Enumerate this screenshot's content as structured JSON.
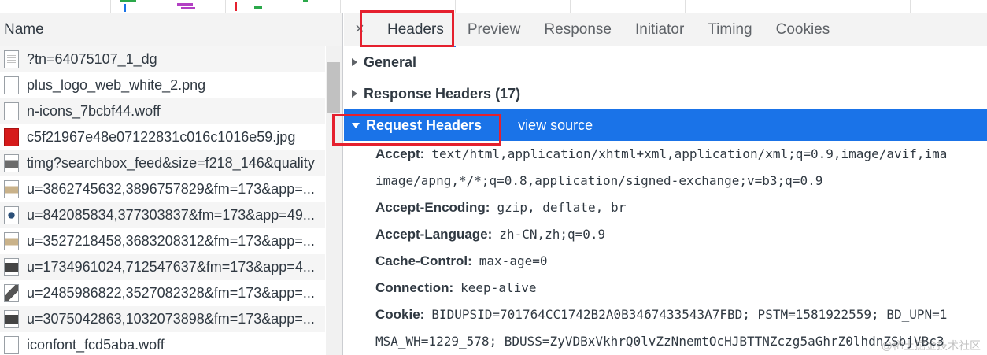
{
  "left": {
    "column_header": "Name",
    "requests": [
      {
        "name": "?tn=64075107_1_dg",
        "icon": "document-icon"
      },
      {
        "name": "plus_logo_web_white_2.png",
        "icon": "file-icon"
      },
      {
        "name": "n-icons_7bcbf44.woff",
        "icon": "file-icon"
      },
      {
        "name": "c5f21967e48e07122831c016c1016e59.jpg",
        "icon": "image-icon"
      },
      {
        "name": "timg?searchbox_feed&size=f218_146&quality",
        "icon": "image-icon"
      },
      {
        "name": "u=3862745632,3896757829&fm=173&app=...",
        "icon": "image-icon"
      },
      {
        "name": "u=842085834,377303837&fm=173&app=49...",
        "icon": "image-icon"
      },
      {
        "name": "u=3527218458,3683208312&fm=173&app=...",
        "icon": "image-icon"
      },
      {
        "name": "u=1734961024,712547637&fm=173&app=4...",
        "icon": "image-icon"
      },
      {
        "name": "u=2485986822,3527082328&fm=173&app=...",
        "icon": "image-icon"
      },
      {
        "name": "u=3075042863,1032073898&fm=173&app=...",
        "icon": "image-icon"
      },
      {
        "name": "iconfont_fcd5aba.woff",
        "icon": "file-icon"
      }
    ]
  },
  "tabs": {
    "close": "×",
    "items": [
      "Headers",
      "Preview",
      "Response",
      "Initiator",
      "Timing",
      "Cookies"
    ],
    "active": "Headers"
  },
  "sections": {
    "general": "General",
    "response_headers": "Response Headers (17)",
    "request_headers": "Request Headers",
    "view_source": "view source"
  },
  "request_headers": {
    "accept_key": "Accept:",
    "accept_val": "text/html,application/xhtml+xml,application/xml;q=0.9,image/avif,ima",
    "accept_cont": "image/apng,*/*;q=0.8,application/signed-exchange;v=b3;q=0.9",
    "encoding_key": "Accept-Encoding:",
    "encoding_val": "gzip, deflate, br",
    "language_key": "Accept-Language:",
    "language_val": "zh-CN,zh;q=0.9",
    "cache_key": "Cache-Control:",
    "cache_val": "max-age=0",
    "connection_key": "Connection:",
    "connection_val": "keep-alive",
    "cookie_key": "Cookie:",
    "cookie_val": "BIDUPSID=701764CC1742B2A0B3467433543A7FBD; PSTM=1581922559; BD_UPN=1",
    "cookie_cont": "MSA_WH=1229_578; BDUSS=ZyVDBxVkhrQ0lvZzNnemtOcHJBTTNZczg5aGhrZ0lhdnZSbjVBc3"
  },
  "watermark": "@稀土掘金技术社区",
  "colors": {
    "selected": "#1a73e8",
    "highlight_box": "#e5202e"
  }
}
